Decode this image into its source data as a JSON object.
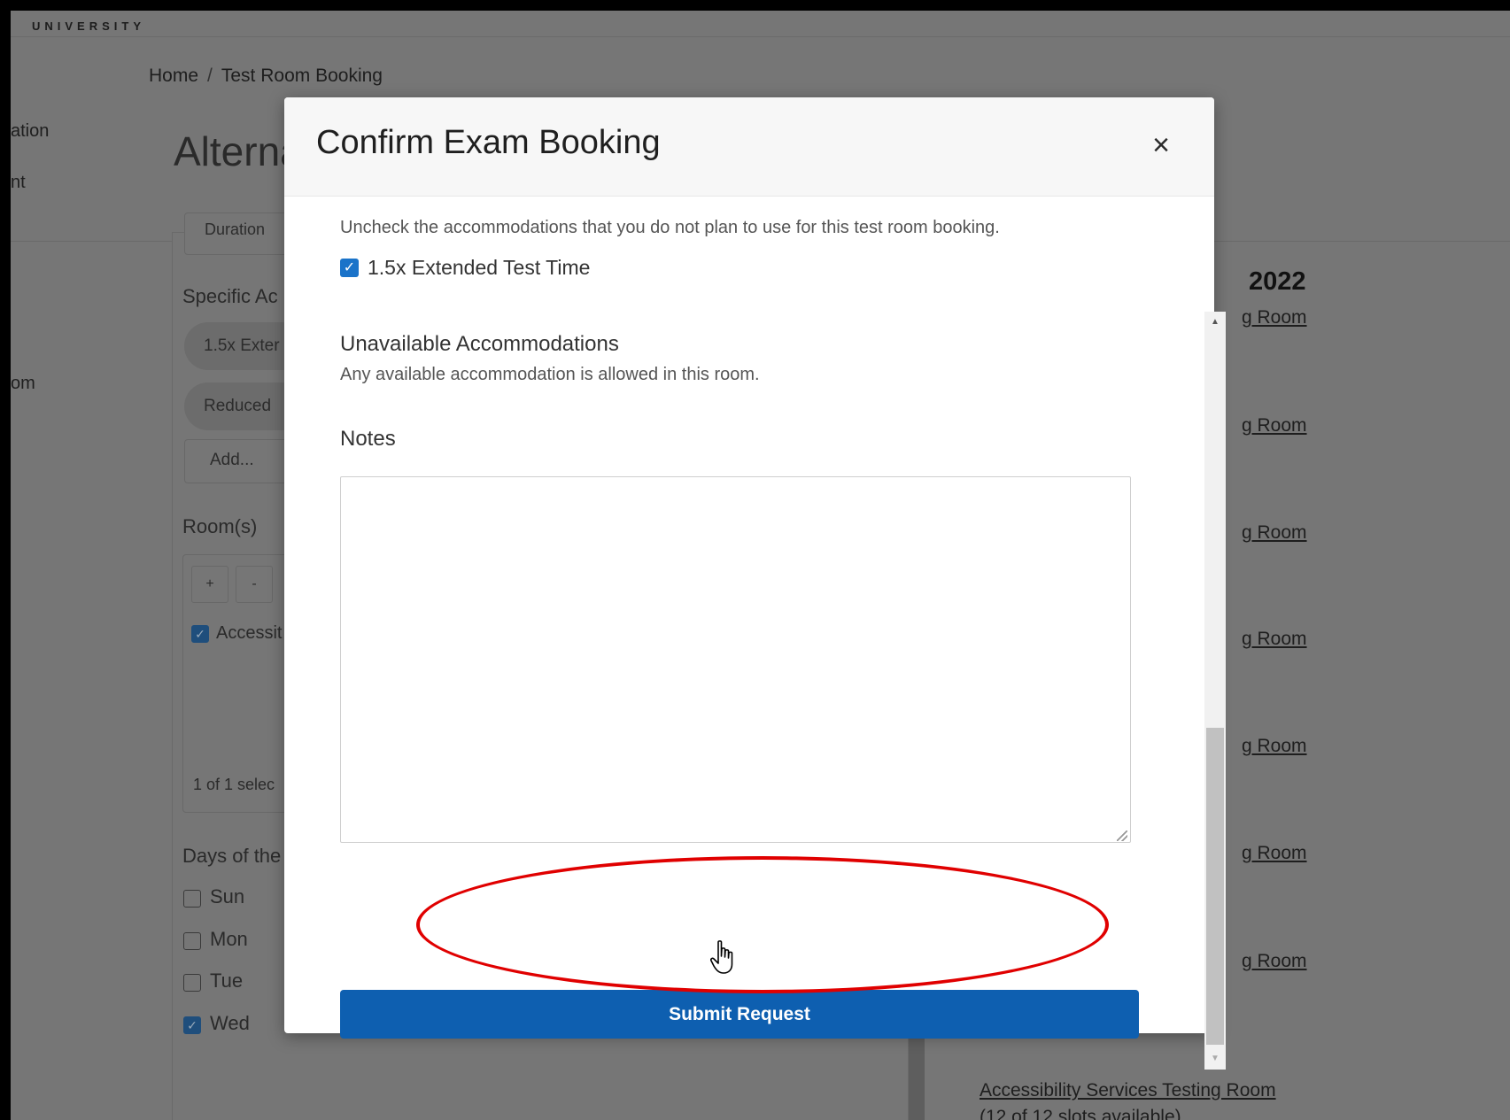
{
  "header": {
    "logo": "UNIVERSITY"
  },
  "breadcrumb": {
    "home": "Home",
    "separator": "/",
    "current": "Test Room Booking"
  },
  "left_nav": {
    "item1": "ation",
    "item2": "nt",
    "item3": "om"
  },
  "page": {
    "title": "Alterna"
  },
  "form": {
    "duration_placeholder": "Duration",
    "specific_accommodations_label": "Specific Ac",
    "chip1": "1.5x Exter",
    "chip2": "Reduced",
    "add_button": "Add...",
    "rooms_label": "Room(s)",
    "plus": "+",
    "minus": "-",
    "room_item": "Accessit",
    "selected_count": "1 of 1 selec",
    "days_label": "Days of the",
    "days": [
      {
        "label": "Sun",
        "checked": false
      },
      {
        "label": "Mon",
        "checked": false
      },
      {
        "label": "Tue",
        "checked": false
      },
      {
        "label": "Wed",
        "checked": true
      }
    ]
  },
  "results": {
    "year": "2022",
    "room_link_fragment": "g Room",
    "last_link": "Accessibility Services Testing Room",
    "last_slots": "(12 of 12 slots available)"
  },
  "modal": {
    "title": "Confirm Exam Booking",
    "close_icon": "×",
    "instructions": "Uncheck the accommodations that you do not plan to use for this test room booking.",
    "accommodation": {
      "label": "1.5x Extended Test Time",
      "checked": true
    },
    "unavailable_title": "Unavailable Accommodations",
    "unavailable_text": "Any available accommodation is allowed in this room.",
    "notes_label": "Notes",
    "notes_value": "",
    "submit_label": "Submit Request"
  },
  "colors": {
    "primary_button": "#0e5fb0",
    "checkbox": "#1a73c9",
    "highlight": "#e00000",
    "overlay": "#767676"
  }
}
